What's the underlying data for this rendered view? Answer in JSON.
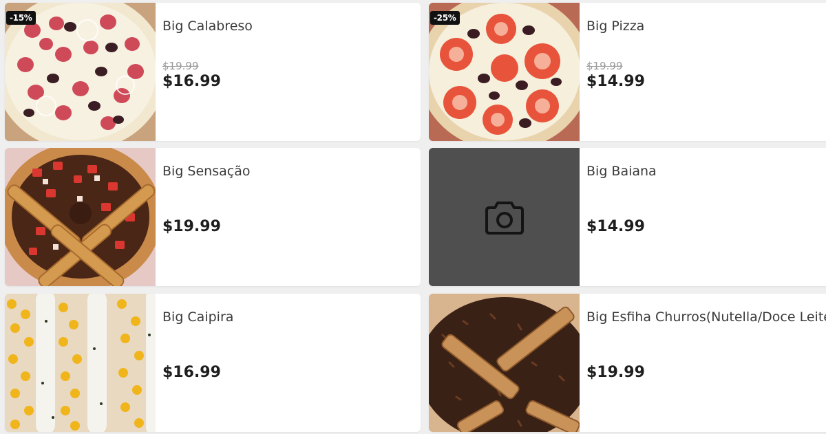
{
  "products": [
    {
      "name": "Big Calabreso",
      "badge": "-15%",
      "old_price": "$19.99",
      "price": "$16.99",
      "image": "pizza-calabresa-photo"
    },
    {
      "name": "Big Pizza",
      "badge": "-25%",
      "old_price": "$19.99",
      "price": "$14.99",
      "image": "pizza-tomato-olive-photo"
    },
    {
      "name": "Big Sensação",
      "price": "$19.99",
      "image": "pizza-strawberry-chocolate-photo"
    },
    {
      "name": "Big Baiana",
      "price": "$14.99",
      "image": "camera-icon"
    },
    {
      "name": "Big Caipira",
      "price": "$16.99",
      "image": "pizza-corn-cream-photo"
    },
    {
      "name": "Big Esfiha Churros(Nutella/Doce Leite)",
      "price": "$19.99",
      "image": "esfiha-churros-sprinkles-photo"
    }
  ],
  "colors": {
    "background": "#efefef",
    "card": "#ffffff",
    "badge": "#111111",
    "placeholder": "#4f4f4f",
    "price": "#1e1e1e",
    "old_price": "#9a9a9a"
  }
}
